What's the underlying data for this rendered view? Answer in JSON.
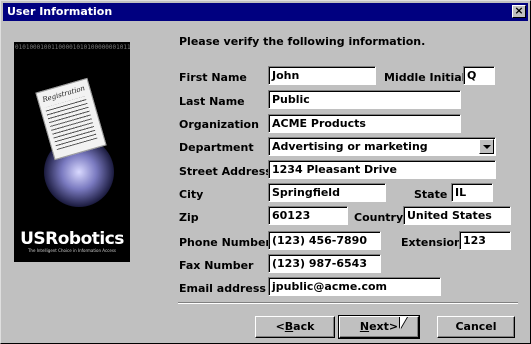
{
  "window": {
    "title": "User Information",
    "close_glyph": "×"
  },
  "promo": {
    "card_label": "Registration",
    "brand": "USRobotics",
    "tagline": "The Intelligent Choice in Information Access",
    "binary": "0101000100110000101010000000101101101001010100110010110100101011010110100101011010110100101010010101101001010110101101001010101011101000100110100101011010010101101010010110100101010110100101011010010101101010010110100101010110100101011010010101101010010110100101010110100101011010010101"
  },
  "instruction": "Please verify the following information.",
  "fields": {
    "first_name": {
      "label": "First Name",
      "value": "John"
    },
    "middle_initial": {
      "label": "Middle Initial",
      "value": "Q"
    },
    "last_name": {
      "label": "Last Name",
      "value": "Public"
    },
    "organization": {
      "label": "Organization",
      "value": "ACME Products"
    },
    "department": {
      "label": "Department",
      "value": "Advertising or marketing"
    },
    "street_address": {
      "label": "Street Address",
      "value": "1234 Pleasant Drive"
    },
    "city": {
      "label": "City",
      "value": "Springfield"
    },
    "state": {
      "label": "State",
      "value": "IL"
    },
    "zip": {
      "label": "Zip",
      "value": "60123"
    },
    "country": {
      "label": "Country",
      "value": "United States"
    },
    "phone": {
      "label": "Phone Number",
      "value": "(123) 456-7890"
    },
    "extension": {
      "label": "Extension",
      "value": "123"
    },
    "fax": {
      "label": "Fax Number",
      "value": "(123) 987-6543"
    },
    "email": {
      "label": "Email address",
      "value": "jpublic@acme.com"
    }
  },
  "buttons": {
    "back": {
      "accel": "B",
      "rest": "ack",
      "prefix": "<"
    },
    "next": {
      "accel": "N",
      "rest": "ext",
      "suffix": ">"
    },
    "cancel": {
      "label": "Cancel"
    }
  },
  "colors": {
    "titlebar": "#000080",
    "face": "#c0c0c0"
  },
  "icons": {
    "close": "close-icon",
    "dropdown": "chevron-down-icon",
    "cursor": "mouse-pointer-icon"
  }
}
